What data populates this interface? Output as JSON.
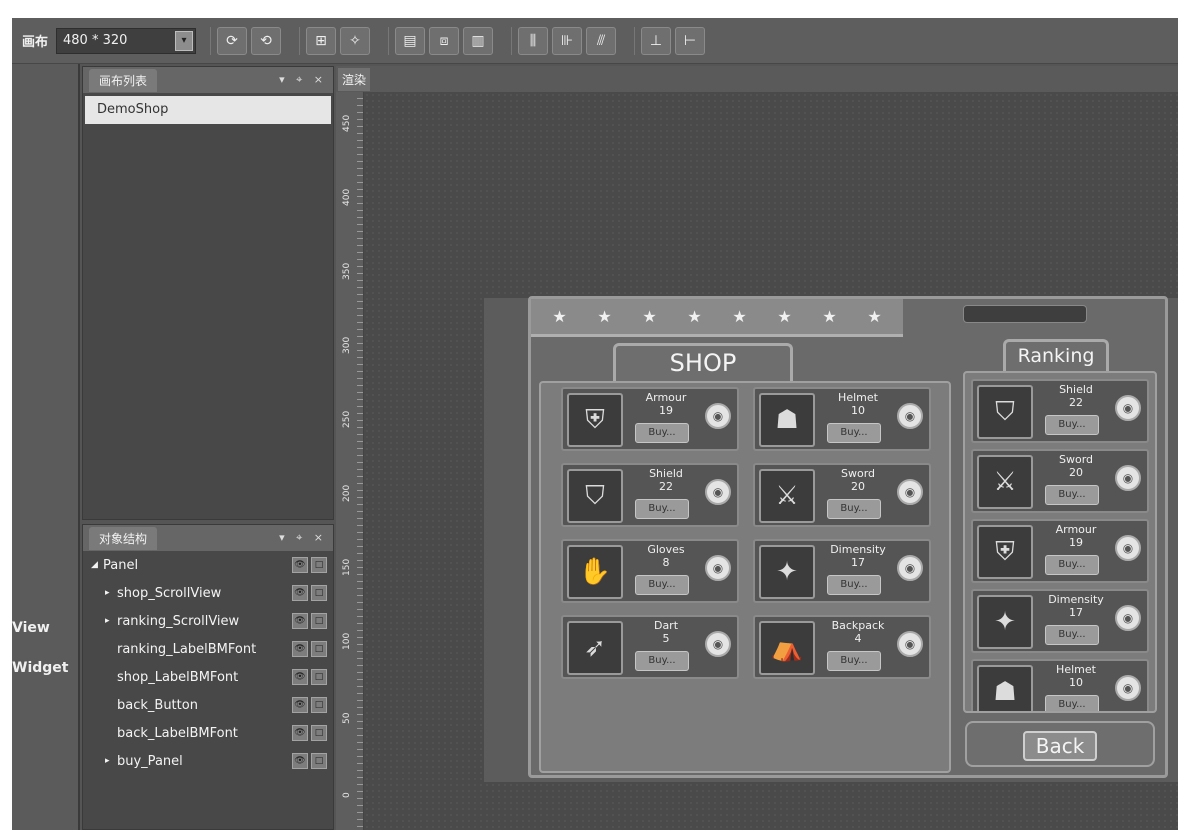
{
  "toolbar": {
    "canvas_label": "画布",
    "size_value": "480 * 320",
    "dropdown_arrow": "▾",
    "groups": [
      [
        "⟳",
        "⟲"
      ],
      [
        "⊞",
        "✧"
      ],
      [
        "▤",
        "⧈",
        "▥"
      ],
      [
        "⫼",
        "⊪",
        "⫻"
      ],
      [
        "⊥",
        "⊢"
      ]
    ]
  },
  "left_strip": {
    "label_view": "View",
    "label_widget": "Widget"
  },
  "canvas_list": {
    "tab": "画布列表",
    "controls": "▾ ⌖ ×",
    "items": [
      "DemoShop"
    ]
  },
  "object_tree": {
    "tab": "对象结构",
    "controls": "▾ ⌖ ×",
    "rows": [
      {
        "label": "Panel",
        "prefix": "◢",
        "indent": 1
      },
      {
        "label": "shop_ScrollView",
        "prefix": "▸",
        "indent": 2
      },
      {
        "label": "ranking_ScrollView",
        "prefix": "▸",
        "indent": 2
      },
      {
        "label": "ranking_LabelBMFont",
        "prefix": "",
        "indent": 2
      },
      {
        "label": "shop_LabelBMFont",
        "prefix": "",
        "indent": 2
      },
      {
        "label": "back_Button",
        "prefix": "",
        "indent": 2
      },
      {
        "label": "back_LabelBMFont",
        "prefix": "",
        "indent": 2
      },
      {
        "label": "buy_Panel",
        "prefix": "▸",
        "indent": 2
      }
    ],
    "row_icon_eye": "👁",
    "row_icon_lock": "□"
  },
  "render": {
    "tab": "渲染",
    "ruler_ticks": [
      "450",
      "400",
      "350",
      "300",
      "250",
      "200",
      "150",
      "100",
      "50",
      "0"
    ]
  },
  "game": {
    "banner_star": "★",
    "banner_stars": 8,
    "shop_title": "SHOP",
    "ranking_title": "Ranking",
    "back_label": "Back",
    "buy_label": "Buy...",
    "coin_symbol": "◉",
    "shop_items": [
      {
        "name": "Armour",
        "value": "19",
        "icon": "⛨"
      },
      {
        "name": "Helmet",
        "value": "10",
        "icon": "☗"
      },
      {
        "name": "Shield",
        "value": "22",
        "icon": "⛉"
      },
      {
        "name": "Sword",
        "value": "20",
        "icon": "⚔"
      },
      {
        "name": "Gloves",
        "value": "8",
        "icon": "✋"
      },
      {
        "name": "Dimensity",
        "value": "17",
        "icon": "✦"
      },
      {
        "name": "Dart",
        "value": "5",
        "icon": "➶"
      },
      {
        "name": "Backpack",
        "value": "4",
        "icon": "⛺"
      }
    ],
    "ranking_items": [
      {
        "name": "Shield",
        "value": "22",
        "icon": "⛉"
      },
      {
        "name": "Sword",
        "value": "20",
        "icon": "⚔"
      },
      {
        "name": "Armour",
        "value": "19",
        "icon": "⛨"
      },
      {
        "name": "Dimensity",
        "value": "17",
        "icon": "✦"
      },
      {
        "name": "Helmet",
        "value": "10",
        "icon": "☗"
      }
    ]
  }
}
